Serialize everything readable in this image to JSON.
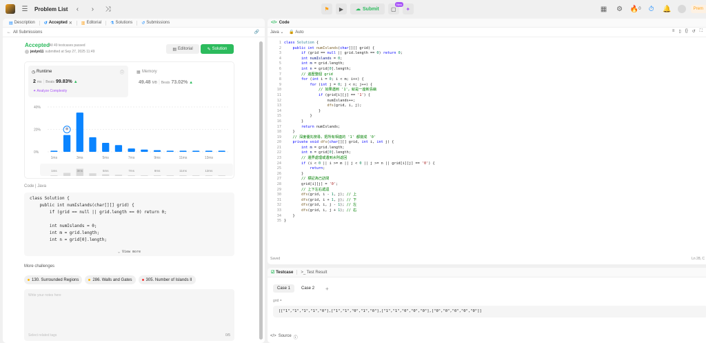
{
  "topbar": {
    "title": "Problem List",
    "submit": "Submit",
    "new_badge": "New",
    "streak": "0",
    "premium": "Prem"
  },
  "left": {
    "tabs": [
      {
        "label": "Description",
        "icon": "description-icon"
      },
      {
        "label": "Accepted",
        "icon": "history-icon"
      },
      {
        "label": "Editorial",
        "icon": "editorial-icon"
      },
      {
        "label": "Solutions",
        "icon": "solutions-icon"
      },
      {
        "label": "Submissions",
        "icon": "submissions-icon"
      }
    ],
    "back": "All Submissions",
    "status": "Accepted",
    "passed": "All 49 testcases passed",
    "user": "jeslyn11",
    "submitted": "submitted at Sep 27, 2025 11:49",
    "editorial_btn": "Editorial",
    "solution_btn": "Solution",
    "runtime": {
      "label": "Runtime",
      "value": "2",
      "unit": "ms",
      "beats_label": "Beats",
      "beats": "99.83%"
    },
    "analyze": "Analyze Complexity",
    "memory": {
      "label": "Memory",
      "value": "49.48",
      "unit": "MB",
      "beats_label": "Beats",
      "beats": "73.02%"
    },
    "code_label": "Code",
    "code_lang": "Java",
    "code_preview": [
      "class Solution {",
      "    public int numIslands(char[][] grid) {",
      "        if (grid == null || grid.length == 0) return 0;",
      "",
      "        int numIslands = 0;",
      "        int m = grid.length;",
      "        int n = grid[0].length;"
    ],
    "view_more": "View more",
    "more_challenges": "More challenges",
    "challenges": [
      {
        "label": "130. Surrounded Regions",
        "color": "#ffb800"
      },
      {
        "label": "286. Walls and Gates",
        "color": "#ffb800"
      },
      {
        "label": "305. Number of Islands II",
        "color": "#f63636"
      }
    ],
    "notes_placeholder": "Write your notes here",
    "tags_placeholder": "Select related tags",
    "notes_count": "0/5"
  },
  "chart_data": {
    "type": "bar",
    "ylabel": "",
    "y_ticks": [
      "40%",
      "20%",
      "0%"
    ],
    "ylim": [
      0,
      40
    ],
    "x_ticks": [
      "1ms",
      "3ms",
      "5ms",
      "7ms",
      "9ms",
      "11ms",
      "13ms"
    ],
    "categories": [
      "1ms",
      "2ms",
      "3ms",
      "4ms",
      "5ms",
      "6ms",
      "7ms",
      "8ms",
      "9ms",
      "10ms",
      "11ms",
      "12ms",
      "13ms",
      "14ms"
    ],
    "values": [
      1,
      15,
      35,
      13,
      8,
      6,
      3,
      2,
      1.5,
      1,
      1,
      1,
      1,
      1
    ],
    "highlight_index": 1,
    "color": "#0a84ff"
  },
  "code": {
    "header": "Code",
    "lang": "Java",
    "mode": "Auto",
    "lines": [
      [
        [
          "kw",
          "class "
        ],
        [
          "ty",
          "Solution"
        ],
        [
          "",
          " {"
        ]
      ],
      [
        [
          "",
          "    "
        ],
        [
          "kw",
          "public int "
        ],
        [
          "fn",
          "numIslands"
        ],
        [
          "",
          "("
        ],
        [
          "kw",
          "char"
        ],
        [
          "",
          "[][] grid) {"
        ]
      ],
      [
        [
          "",
          "        "
        ],
        [
          "kw",
          "if "
        ],
        [
          "",
          "(grid == "
        ],
        [
          "kw",
          "null"
        ],
        [
          "",
          " || grid.length == "
        ],
        [
          "nm",
          "0"
        ],
        [
          "",
          ") "
        ],
        [
          "kw",
          "return "
        ],
        [
          "nm",
          "0"
        ],
        [
          "",
          ";"
        ]
      ],
      [
        [
          "",
          "        "
        ],
        [
          "kw",
          "int "
        ],
        [
          "vr",
          "numIslands"
        ],
        [
          "",
          " = "
        ],
        [
          "nm",
          "0"
        ],
        [
          "",
          ";"
        ]
      ],
      [
        [
          "",
          "        "
        ],
        [
          "kw",
          "int "
        ],
        [
          "vr",
          "m"
        ],
        [
          "",
          " = grid.length;"
        ]
      ],
      [
        [
          "",
          "        "
        ],
        [
          "kw",
          "int "
        ],
        [
          "vr",
          "n"
        ],
        [
          "",
          " = grid["
        ],
        [
          "nm",
          "0"
        ],
        [
          "",
          "].length;"
        ]
      ],
      [
        [
          "",
          "        "
        ],
        [
          "cm",
          "// 遍歷整個 grid"
        ]
      ],
      [
        [
          "",
          "        "
        ],
        [
          "kw",
          "for "
        ],
        [
          "",
          "("
        ],
        [
          "kw",
          "int "
        ],
        [
          "",
          "i = "
        ],
        [
          "nm",
          "0"
        ],
        [
          "",
          "; i < m; i++) {"
        ]
      ],
      [
        [
          "",
          "            "
        ],
        [
          "kw",
          "for "
        ],
        [
          "",
          "("
        ],
        [
          "kw",
          "int "
        ],
        [
          "",
          "j = "
        ],
        [
          "nm",
          "0"
        ],
        [
          "",
          "; j < n; j++) {"
        ]
      ],
      [
        [
          "",
          "                "
        ],
        [
          "cm",
          "// 如果遇到 '1'，就是一座新島嶼"
        ]
      ],
      [
        [
          "",
          "                "
        ],
        [
          "kw",
          "if "
        ],
        [
          "",
          "(grid[i][j] == "
        ],
        [
          "st",
          "'1'"
        ],
        [
          "",
          ") {"
        ]
      ],
      [
        [
          "",
          "                    numIslands++;"
        ]
      ],
      [
        [
          "",
          "                    "
        ],
        [
          "fn",
          "dfs"
        ],
        [
          "",
          "(grid, i, j);"
        ]
      ],
      [
        [
          "",
          "                }"
        ]
      ],
      [
        [
          "",
          "            }"
        ]
      ],
      [
        [
          "",
          "        }"
        ]
      ],
      [
        [
          "",
          "        "
        ],
        [
          "kw",
          "return "
        ],
        [
          "",
          "numIslands;"
        ]
      ],
      [
        [
          "",
          "    }"
        ]
      ],
      [
        [
          "",
          "    "
        ],
        [
          "cm",
          "// 深度優先搜尋，把所有相連的 '1' 都變成 '0'"
        ]
      ],
      [
        [
          "",
          "    "
        ],
        [
          "kw",
          "private void "
        ],
        [
          "fn",
          "dfs"
        ],
        [
          "",
          "("
        ],
        [
          "kw",
          "char"
        ],
        [
          "",
          "[][] grid, "
        ],
        [
          "kw",
          "int "
        ],
        [
          "",
          "i, "
        ],
        [
          "kw",
          "int "
        ],
        [
          "",
          "j) {"
        ]
      ],
      [
        [
          "",
          "        "
        ],
        [
          "kw",
          "int "
        ],
        [
          "vr",
          "m"
        ],
        [
          "",
          " = grid.length;"
        ]
      ],
      [
        [
          "",
          "        "
        ],
        [
          "kw",
          "int "
        ],
        [
          "vr",
          "n"
        ],
        [
          "",
          " = grid["
        ],
        [
          "nm",
          "0"
        ],
        [
          "",
          "].length;"
        ]
      ],
      [
        [
          "",
          "        "
        ],
        [
          "cm",
          "// 邊界處理或遇到水則返回"
        ]
      ],
      [
        [
          "",
          "        "
        ],
        [
          "kw",
          "if "
        ],
        [
          "",
          "(i < "
        ],
        [
          "nm",
          "0"
        ],
        [
          "",
          " || i >= m || j < "
        ],
        [
          "nm",
          "0"
        ],
        [
          "",
          " || j >= n || grid[i][j] == "
        ],
        [
          "st",
          "'0'"
        ],
        [
          "",
          ") {"
        ]
      ],
      [
        [
          "",
          "            "
        ],
        [
          "kw",
          "return"
        ],
        [
          "",
          ";"
        ]
      ],
      [
        [
          "",
          "        }"
        ]
      ],
      [
        [
          "",
          "        "
        ],
        [
          "cm",
          "// 標記為已訪問"
        ]
      ],
      [
        [
          "",
          "        grid[i][j] = "
        ],
        [
          "st",
          "'0'"
        ],
        [
          "",
          ";"
        ]
      ],
      [
        [
          "",
          "        "
        ],
        [
          "cm",
          "// 上下左右遞迴"
        ]
      ],
      [
        [
          "",
          "        "
        ],
        [
          "fn",
          "dfs"
        ],
        [
          "",
          "(grid, i - "
        ],
        [
          "nm",
          "1"
        ],
        [
          "",
          ", j); "
        ],
        [
          "cm",
          "// 上"
        ]
      ],
      [
        [
          "",
          "        "
        ],
        [
          "fn",
          "dfs"
        ],
        [
          "",
          "(grid, i + "
        ],
        [
          "nm",
          "1"
        ],
        [
          "",
          ", j); "
        ],
        [
          "cm",
          "// 下"
        ]
      ],
      [
        [
          "",
          "        "
        ],
        [
          "fn",
          "dfs"
        ],
        [
          "",
          "(grid, i, j - "
        ],
        [
          "nm",
          "1"
        ],
        [
          "",
          "); "
        ],
        [
          "cm",
          "// 左"
        ]
      ],
      [
        [
          "",
          "        "
        ],
        [
          "fn",
          "dfs"
        ],
        [
          "",
          "(grid, i, j + "
        ],
        [
          "nm",
          "1"
        ],
        [
          "",
          "); "
        ],
        [
          "cm",
          "// 右"
        ]
      ],
      [
        [
          "",
          "    }"
        ]
      ],
      [
        [
          "",
          "}"
        ]
      ]
    ],
    "saved": "Saved",
    "cursor": "Ln 28, C"
  },
  "test": {
    "tab_testcase": "Testcase",
    "tab_result": "Test Result",
    "cases": [
      "Case 1",
      "Case 2"
    ],
    "add": "+",
    "param_label": "grid =",
    "param_value": "[[\"1\",\"1\",\"1\",\"1\",\"0\"],[\"1\",\"1\",\"0\",\"1\",\"0\"],[\"1\",\"1\",\"0\",\"0\",\"0\"],[\"0\",\"0\",\"0\",\"0\",\"0\"]]",
    "source": "Source"
  }
}
